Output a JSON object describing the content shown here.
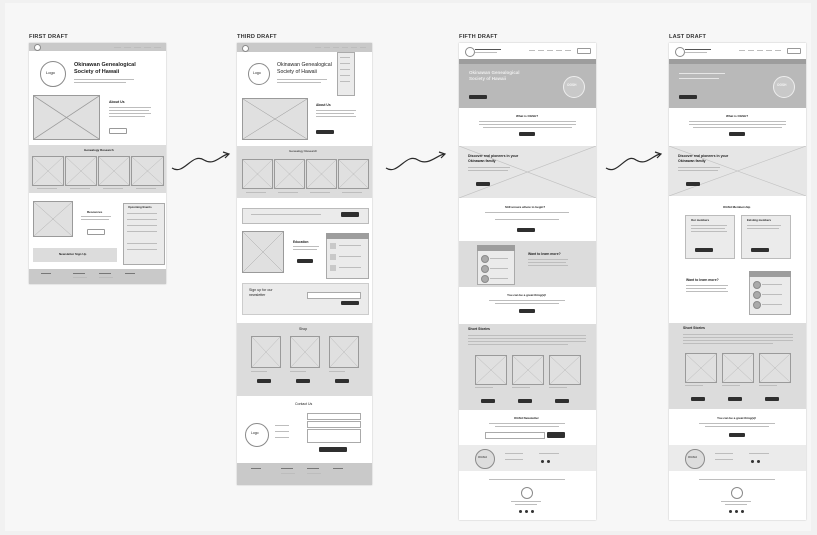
{
  "drafts": [
    {
      "id": "first",
      "label": "FIRST DRAFT"
    },
    {
      "id": "third",
      "label": "THIRD DRAFT"
    },
    {
      "id": "fifth",
      "label": "FIFTH DRAFT"
    },
    {
      "id": "last",
      "label": "LAST DRAFT"
    }
  ],
  "first_draft": {
    "logo": "Logo",
    "hero_title_line1": "Okinawan Genealogical",
    "hero_title_line2": "Society of Hawaii",
    "about_heading": "About Us",
    "sections": [
      "Genealogy Research",
      "Resources",
      "Upcoming Events",
      "Newsletter Sign Up"
    ]
  },
  "third_draft": {
    "logo": "Logo",
    "hero_title_line1": "Okinawan Genealogical",
    "hero_title_line2": "Society of Hawaii",
    "about_heading": "About Us",
    "research_heading": "Genealogy Research",
    "education_heading": "Education",
    "signup_heading_line1": "Sign up for our",
    "signup_heading_line2": "newsletter",
    "shop_heading": "Shop",
    "contact_heading": "Contact Us",
    "footer_logo": "Logo"
  },
  "fifth_draft": {
    "hero_title_line1": "Okinawan Genealogical",
    "hero_title_line2": "Society of Hawaii",
    "what_heading": "What is OGSH?",
    "discover_heading_line1": "Discover real pioneers in your",
    "discover_heading_line2": "Okinawan family",
    "start_heading": "Still unsure where to begin?",
    "learn_heading": "Want to learn more?",
    "give_heading": "You can be a great thing(s)!",
    "stories_heading": "Short Stories",
    "newsletter_heading": "OGSH Newsletter",
    "seal": "OGSH"
  },
  "last_draft": {
    "what_heading": "What is OGSH?",
    "discover_heading_line1": "Discover real pioneers in your",
    "discover_heading_line2": "Okinawan family",
    "membership_heading": "OGSH Membership",
    "members_col": "Our members",
    "existing_col": "Existing members",
    "learn_heading": "Want to learn more?",
    "stories_heading": "Short Stories",
    "give_heading": "You can be a great thing(s)!",
    "seal": "OGSH"
  },
  "colors": {
    "accent_dark": "#2f2f2f",
    "wire_gray": "#dcdcdc",
    "board": "#f7f7f7"
  }
}
